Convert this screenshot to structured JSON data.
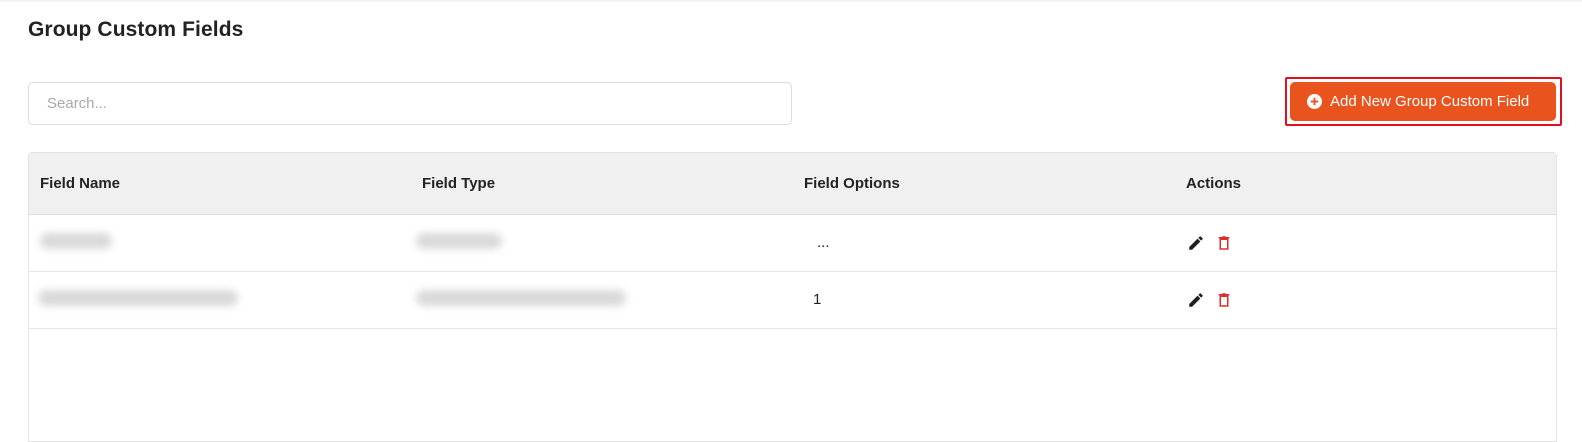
{
  "page": {
    "title": "Group Custom Fields"
  },
  "search": {
    "placeholder": "Search...",
    "value": ""
  },
  "add_button": {
    "label": "Add New Group Custom Field",
    "icon": "plus-circle-icon",
    "color": "#e9531e",
    "highlight_color": "#e0101c"
  },
  "table": {
    "headers": [
      "Field Name",
      "Field Type",
      "Field Options",
      "Actions"
    ],
    "rows": [
      {
        "field_name": "",
        "field_type": "",
        "field_options": "...",
        "actions": [
          "edit-icon",
          "trash-icon"
        ]
      },
      {
        "field_name": "",
        "field_type": "",
        "field_options": "1",
        "actions": [
          "edit-icon",
          "trash-icon"
        ]
      }
    ]
  },
  "colors": {
    "edit_icon": "#1f1f1f",
    "delete_icon": "#d9302c"
  }
}
